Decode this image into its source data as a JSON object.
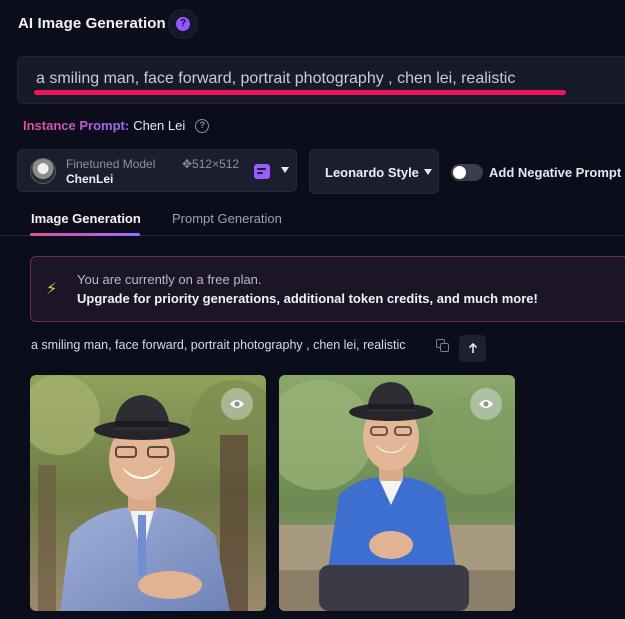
{
  "header": {
    "title": "AI Image Generation",
    "help_icon": "question-icon",
    "help_glyph": "?"
  },
  "prompt": {
    "value": "a smiling man, face forward, portrait photography , chen lei, realistic"
  },
  "instance_prompt": {
    "label": "Instance Prompt:",
    "value": "Chen Lei",
    "help_glyph": "?"
  },
  "model_selector": {
    "label": "Finetuned Model",
    "name": "ChenLei",
    "size": "✥512×512"
  },
  "style_selector": {
    "value": "Leonardo Style"
  },
  "negative_prompt_toggle": {
    "label": "Add Negative Prompt",
    "enabled": false
  },
  "tabs": [
    {
      "label": "Image Generation",
      "active": true
    },
    {
      "label": "Prompt Generation",
      "active": false
    }
  ],
  "plan_banner": {
    "icon": "lightning-icon",
    "icon_glyph": "⚡",
    "line1": "You are currently on a free plan.",
    "line2": "Upgrade for priority generations, additional token credits, and much more!"
  },
  "generation": {
    "prompt": "a smiling man, face forward, portrait photography , chen lei, realistic",
    "images": [
      {
        "description": "elderly smiling man in grey jacket and fedora hat, trees background"
      },
      {
        "description": "elderly smiling man in blue suit and fedora hat seated, trees background"
      }
    ]
  },
  "colors": {
    "background": "#0b0e1a",
    "accent_pink": "#f0155a",
    "accent_purple": "#9b5cff",
    "warning_yellow": "#f6c343"
  }
}
